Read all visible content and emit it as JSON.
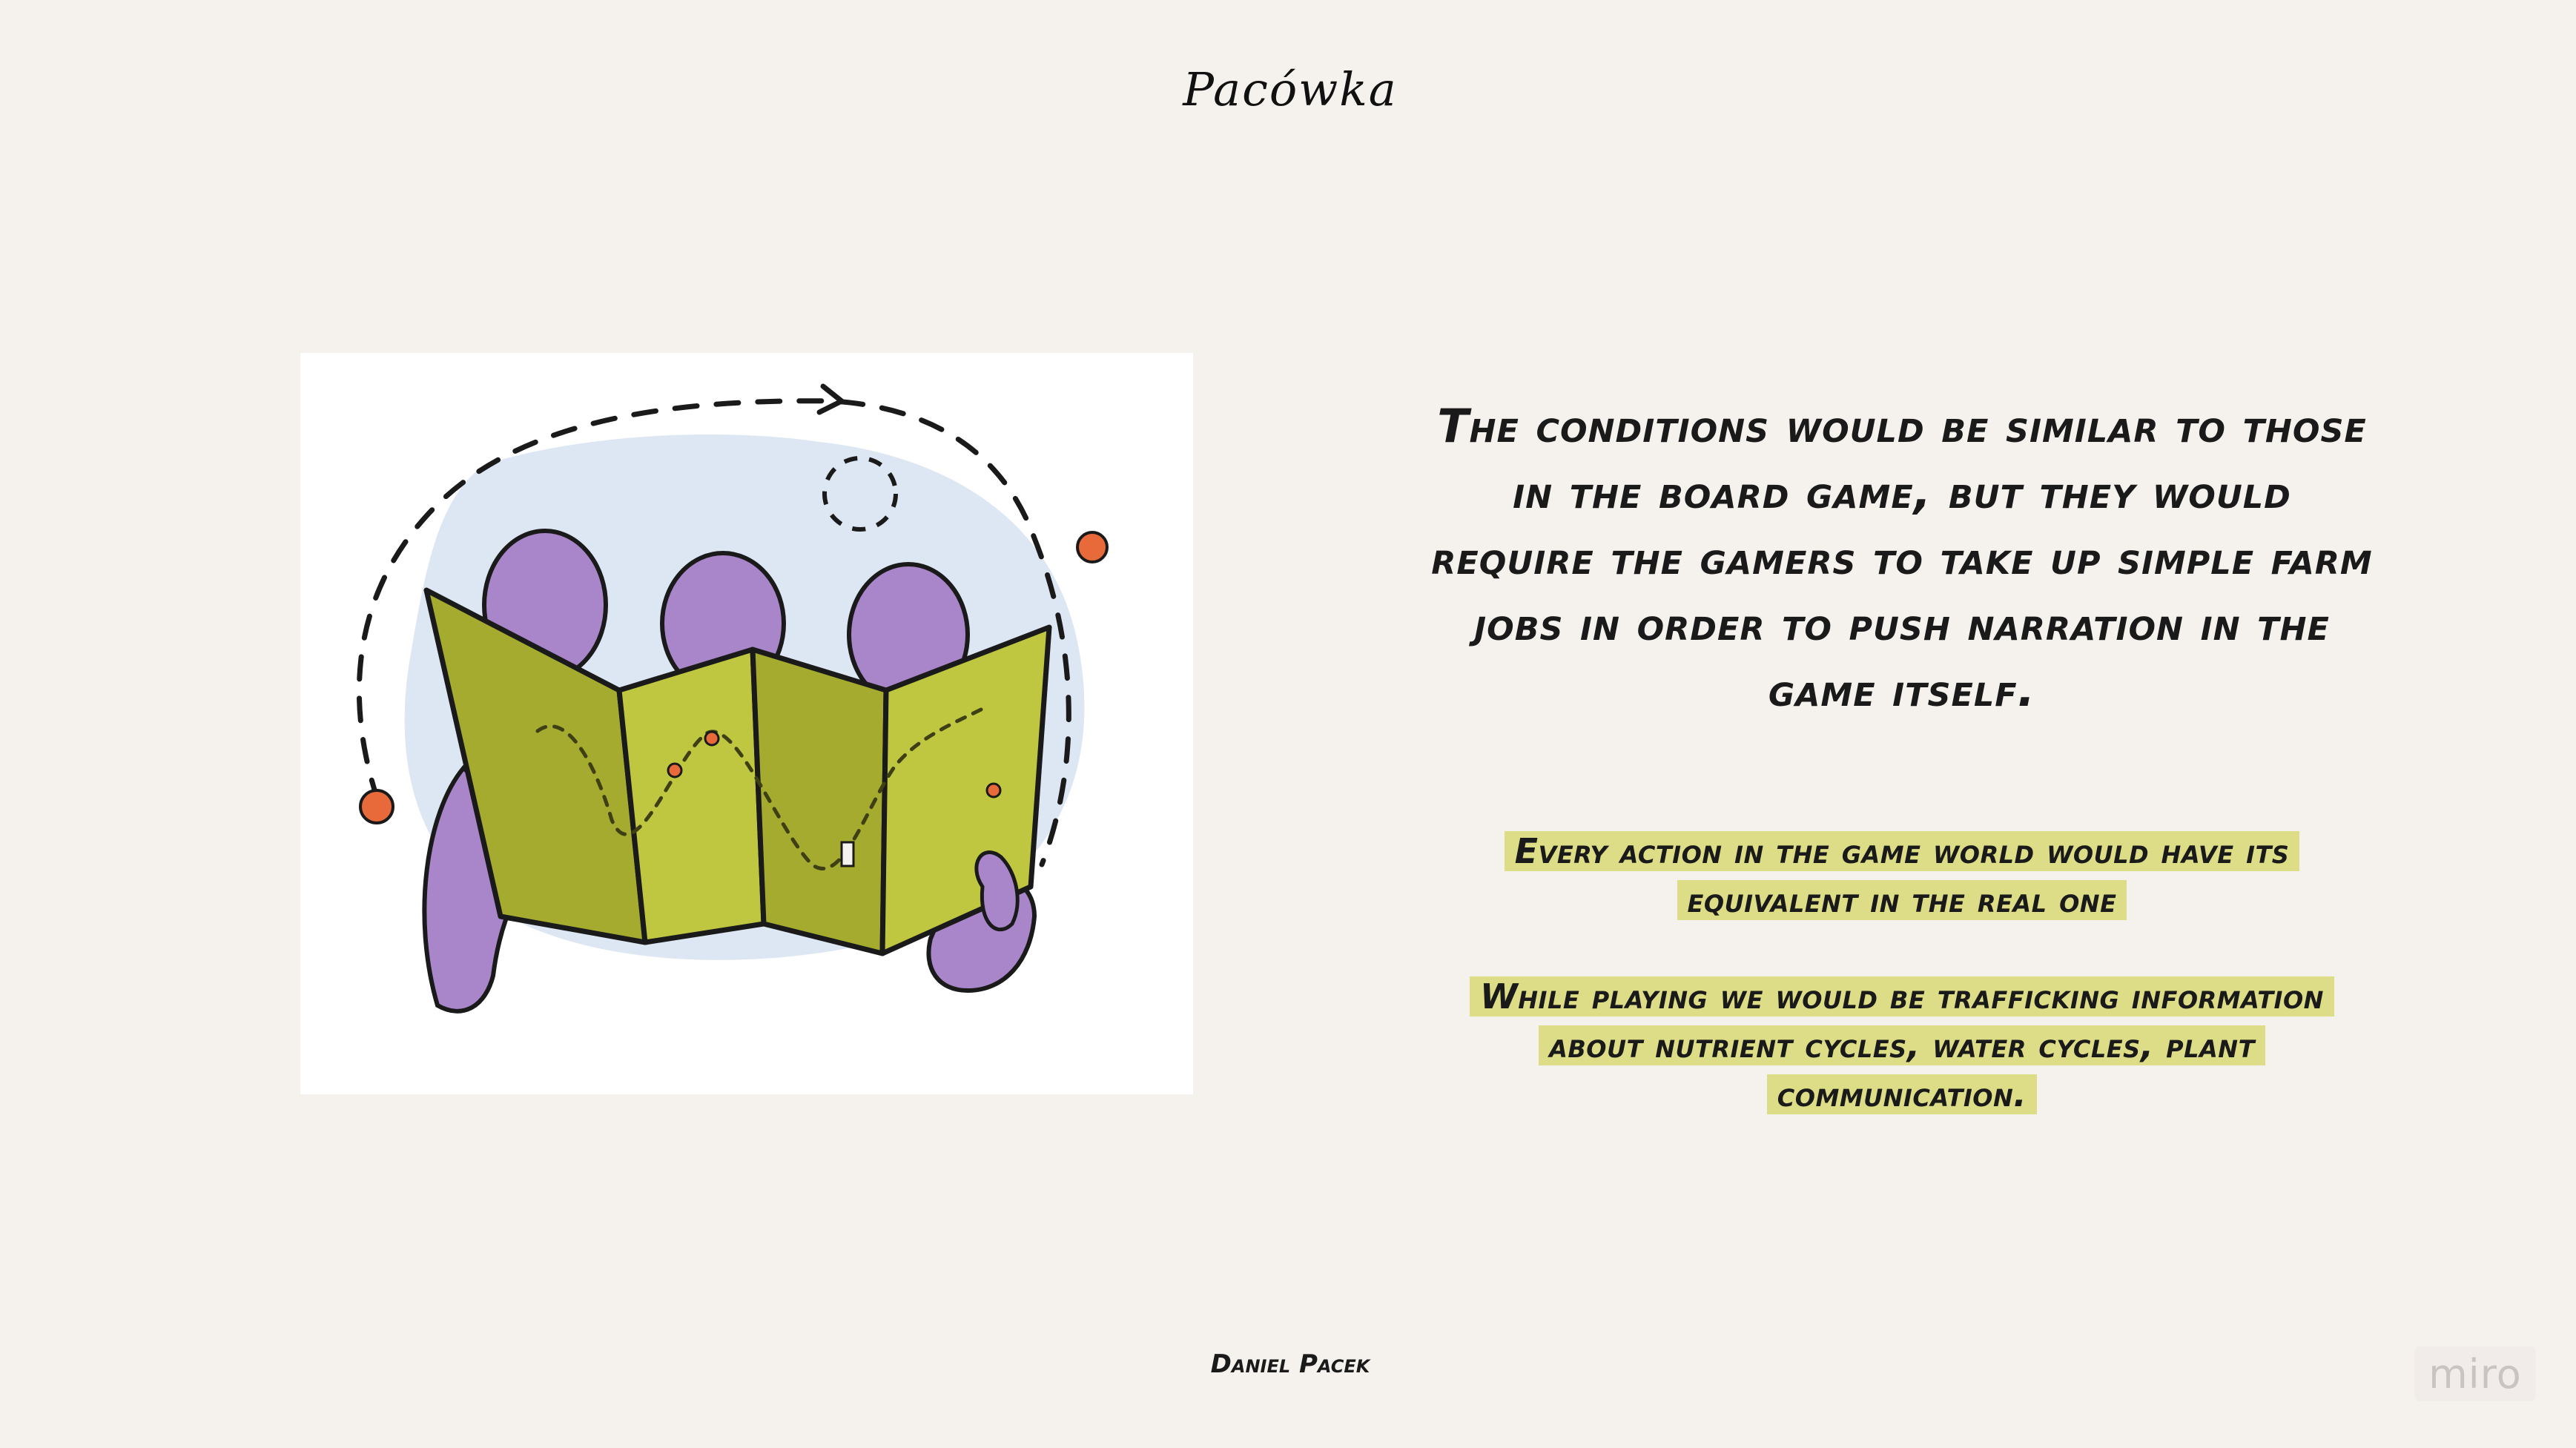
{
  "header": {
    "logo_text": "Pacówka"
  },
  "illustration": {
    "icon": "three-figures-reading-map-illustration",
    "colors": {
      "blob": "#dde6f3",
      "figures": "#a986c9",
      "map": "#a4ab2f",
      "dots": "#e86a3a"
    }
  },
  "main": {
    "headline": "The conditions would be similar to those in the board game, but they would require the gamers to take up simple farm jobs in order to push narration in the game itself.",
    "paragraph_1": "Every action in the game world would have its equivalent in the real one",
    "paragraph_2": "While playing we would be trafficking information about nutrient cycles, water cycles, plant communication.",
    "highlight_color": "#dedd87"
  },
  "footer": {
    "author": "Daniel Pacek"
  },
  "watermark": {
    "label": "miro"
  }
}
